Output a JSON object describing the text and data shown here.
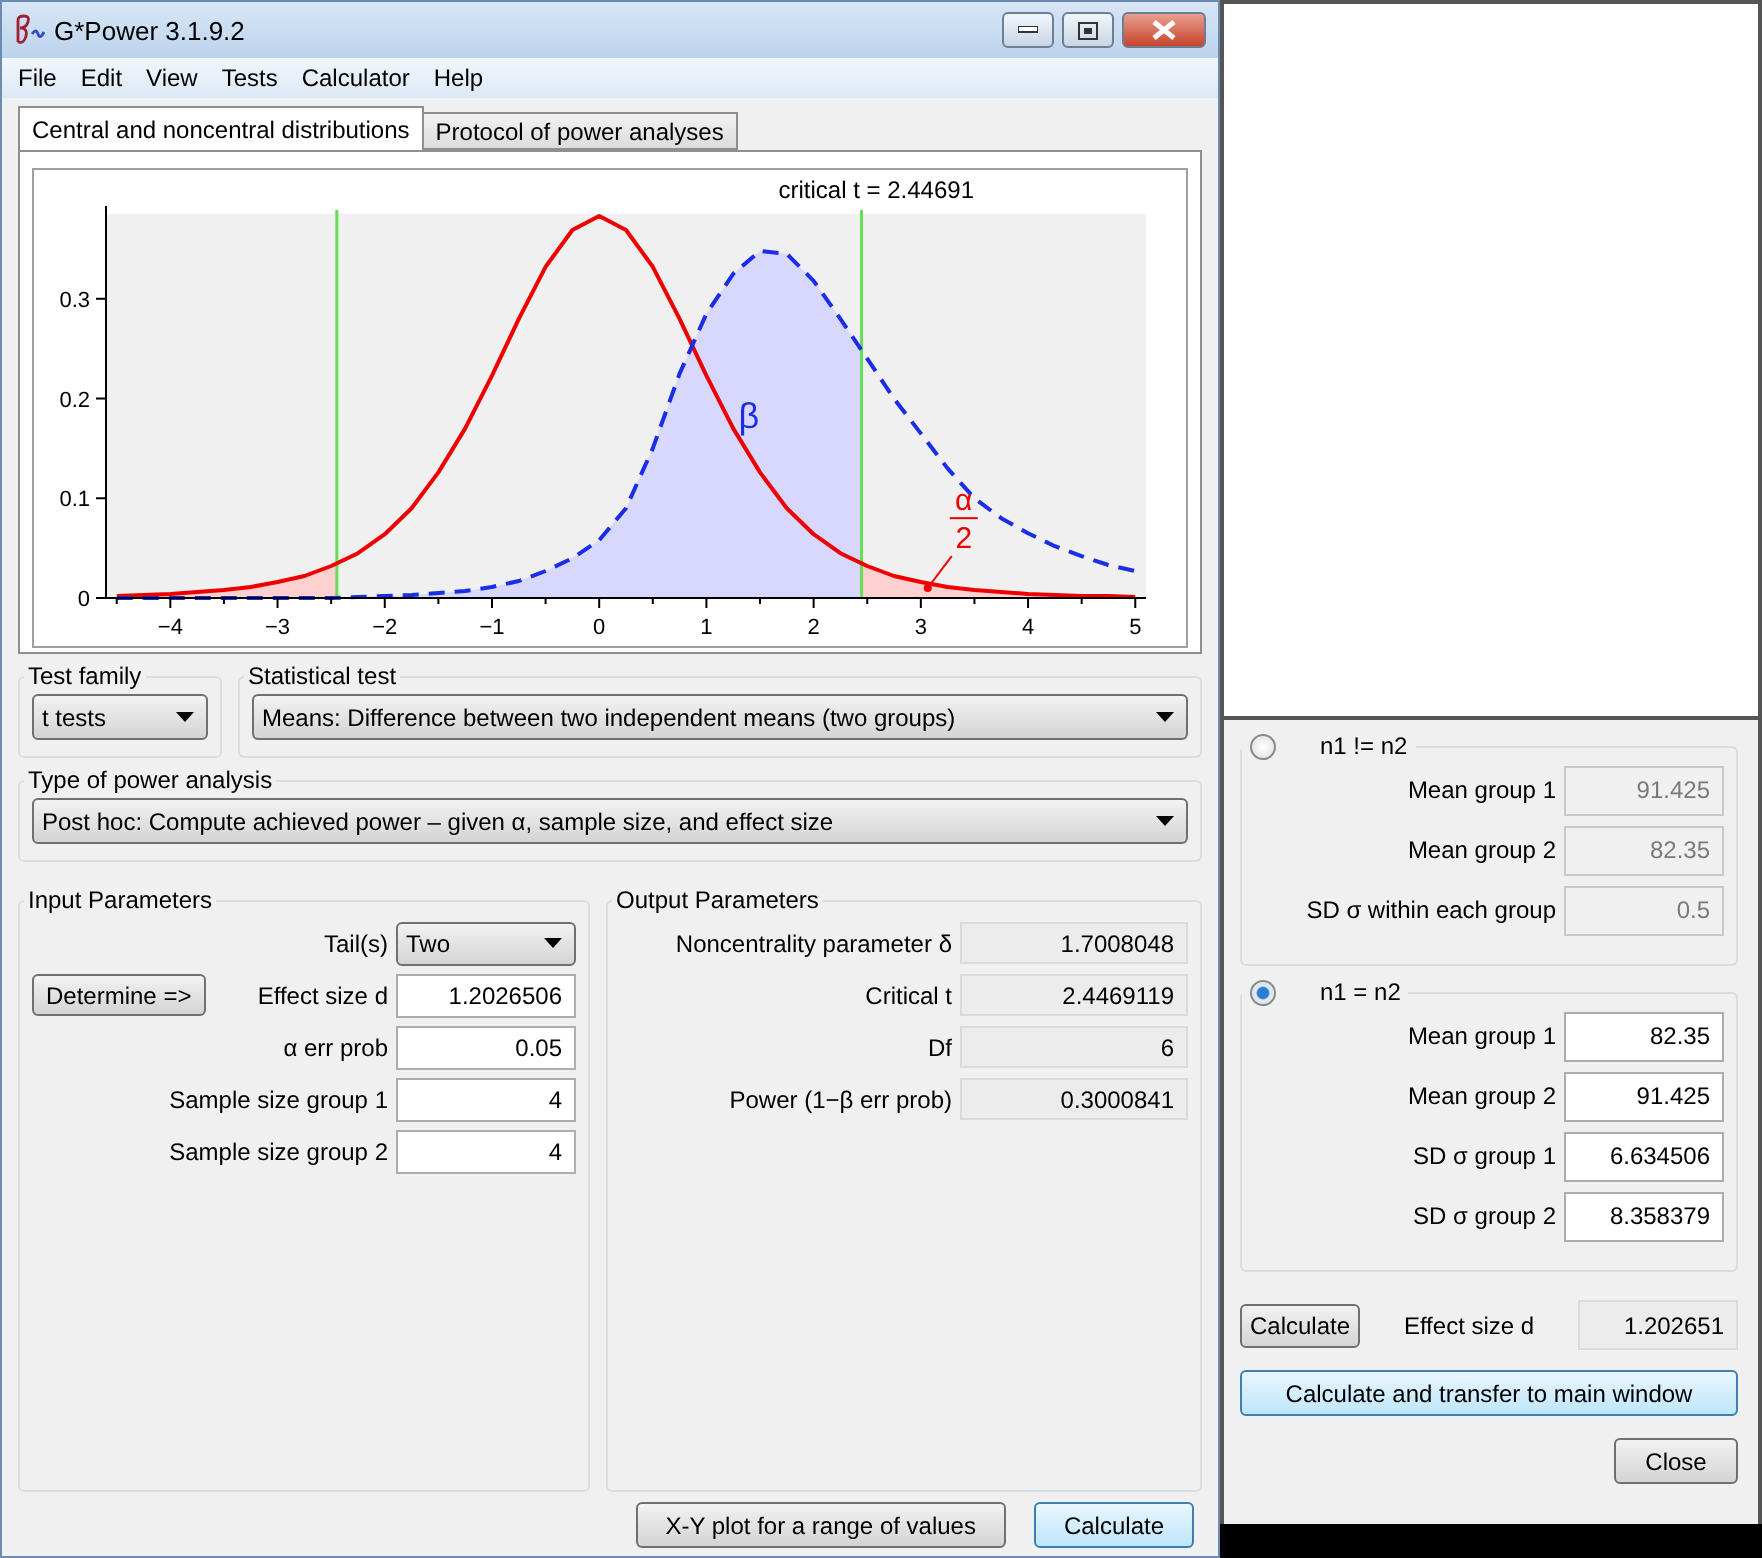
{
  "window": {
    "title": "G*Power 3.1.9.2"
  },
  "menu": [
    "File",
    "Edit",
    "View",
    "Tests",
    "Calculator",
    "Help"
  ],
  "tabs": [
    {
      "label": "Central and noncentral distributions",
      "selected": true
    },
    {
      "label": "Protocol of power analyses",
      "selected": false
    }
  ],
  "plot": {
    "chart_data": {
      "type": "line",
      "title": "critical t = 2.44691",
      "x": [
        -4.5,
        -4.25,
        -4,
        -3.75,
        -3.5,
        -3.25,
        -3,
        -2.75,
        -2.5,
        -2.25,
        -2,
        -1.75,
        -1.5,
        -1.25,
        -1,
        -0.75,
        -0.5,
        -0.25,
        0,
        0.25,
        0.5,
        0.75,
        1,
        1.25,
        1.5,
        1.75,
        2,
        2.25,
        2.5,
        2.75,
        3,
        3.25,
        3.5,
        3.75,
        4,
        4.25,
        4.5,
        4.75,
        5
      ],
      "series": [
        {
          "color": "#ee0000",
          "line_style": "solid",
          "values": [
            0.002,
            0.003,
            0.004,
            0.006,
            0.008,
            0.011,
            0.016,
            0.022,
            0.032,
            0.045,
            0.064,
            0.09,
            0.126,
            0.17,
            0.223,
            0.28,
            0.332,
            0.369,
            0.383,
            0.369,
            0.332,
            0.28,
            0.223,
            0.17,
            0.126,
            0.09,
            0.064,
            0.045,
            0.032,
            0.022,
            0.016,
            0.011,
            0.008,
            0.006,
            0.004,
            0.003,
            0.002,
            0.002,
            0.001
          ]
        },
        {
          "color": "#1a2ee8",
          "line_style": "dashed",
          "values": [
            0,
            0,
            0,
            0,
            0,
            0,
            0,
            0,
            0,
            0.001,
            0.002,
            0.003,
            0.005,
            0.007,
            0.011,
            0.017,
            0.027,
            0.04,
            0.058,
            0.09,
            0.15,
            0.225,
            0.285,
            0.325,
            0.348,
            0.345,
            0.318,
            0.28,
            0.24,
            0.2,
            0.165,
            0.13,
            0.1,
            0.08,
            0.065,
            0.052,
            0.042,
            0.033,
            0.027
          ]
        }
      ],
      "xlim": [
        -4.6,
        5.1
      ],
      "ylim": [
        0,
        0.385
      ],
      "xticks": [
        -4,
        -3,
        -2,
        -1,
        0,
        1,
        2,
        3,
        4,
        5
      ],
      "yticks": [
        0,
        0.1,
        0.2,
        0.3
      ],
      "ref_lines": [
        {
          "axis": "x",
          "value": -2.447,
          "color": "#66dd55"
        },
        {
          "axis": "x",
          "value": 2.447,
          "color": "#66dd55"
        }
      ],
      "annotations": [
        "β",
        "α",
        "2"
      ]
    }
  },
  "test_family": {
    "label": "Test family",
    "value": "t tests"
  },
  "statistical_test": {
    "label": "Statistical test",
    "value": "Means: Difference between two independent means (two groups)"
  },
  "power_analysis": {
    "label": "Type of power analysis",
    "value": "Post hoc: Compute achieved power – given α, sample size, and effect size"
  },
  "input_parameters": {
    "title": "Input Parameters",
    "rows": [
      {
        "kind": "dropdown",
        "label": "Tail(s)",
        "value": "Two"
      },
      {
        "kind": "field",
        "label": "Effect size d",
        "value": "1.2026506",
        "button": "Determine =>"
      },
      {
        "kind": "field",
        "label": "α err prob",
        "value": "0.05"
      },
      {
        "kind": "field",
        "label": "Sample size group 1",
        "value": "4"
      },
      {
        "kind": "field",
        "label": "Sample size group 2",
        "value": "4"
      }
    ]
  },
  "output_parameters": {
    "title": "Output Parameters",
    "rows": [
      {
        "label": "Noncentrality parameter δ",
        "value": "1.7008048"
      },
      {
        "label": "Critical t",
        "value": "2.4469119"
      },
      {
        "label": "Df",
        "value": "6"
      },
      {
        "label": "Power (1−β err prob)",
        "value": "0.3000841"
      }
    ]
  },
  "buttons": [
    "X-Y plot for a range of values",
    "Calculate"
  ],
  "effect_size_panel": {
    "groups": [
      {
        "label": "n1 != n2",
        "selected": false,
        "rows": [
          {
            "label": "Mean group 1",
            "value": "91.425"
          },
          {
            "label": "Mean group 2",
            "value": "82.35"
          },
          {
            "label": "SD σ within each group",
            "value": "0.5"
          }
        ]
      },
      {
        "label": "n1 = n2",
        "selected": true,
        "rows": [
          {
            "label": "Mean group 1",
            "value": "82.35"
          },
          {
            "label": "Mean group 2",
            "value": "91.425"
          },
          {
            "label": "SD σ group 1",
            "value": "6.634506"
          },
          {
            "label": "SD σ group 2",
            "value": "8.358379"
          }
        ]
      }
    ],
    "calculate_button": "Calculate",
    "effect_size": {
      "label": "Effect size d",
      "value": "1.202651"
    },
    "transfer_button": "Calculate and transfer to main window",
    "close_button": "Close"
  }
}
